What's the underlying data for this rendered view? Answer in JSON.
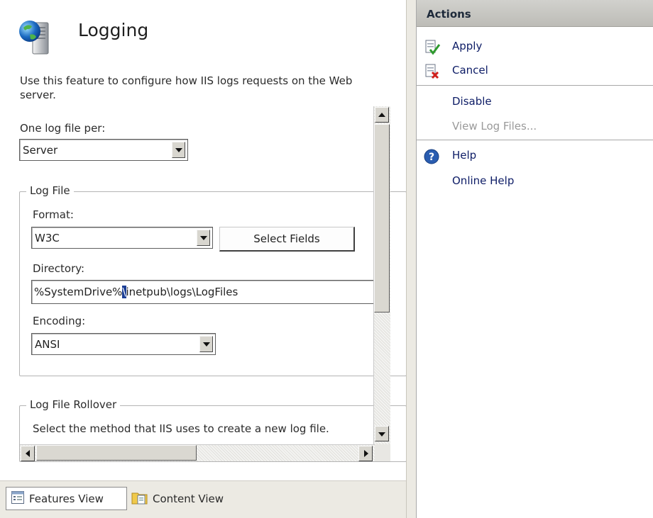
{
  "page": {
    "title": "Logging",
    "description": "Use this feature to configure how IIS logs requests on the Web server."
  },
  "log_per": {
    "label": "One log file per:",
    "value": "Server"
  },
  "log_file": {
    "group_title": "Log File",
    "format_label": "Format:",
    "format_value": "W3C",
    "select_fields_label": "Select Fields",
    "directory_label": "Directory:",
    "directory_value_before": "%SystemDrive%",
    "directory_value_selected": "\\",
    "directory_value_after": "inetpub\\logs\\LogFiles",
    "encoding_label": "Encoding:",
    "encoding_value": "ANSI"
  },
  "rollover": {
    "group_title": "Log File Rollover",
    "description": "Select the method that IIS uses to create a new log file."
  },
  "view_tabs": {
    "features": "Features View",
    "content": "Content View"
  },
  "actions": {
    "header": "Actions",
    "apply": "Apply",
    "cancel": "Cancel",
    "disable": "Disable",
    "view_log_files": "View Log Files...",
    "help": "Help",
    "online_help": "Online Help"
  },
  "colors": {
    "link": "#0d1c66",
    "disabled": "#9a9a9a",
    "selection": "#1c3f95",
    "apply_check": "#2e9a2e",
    "cancel_x": "#d0201c",
    "help_blue": "#2a5db0"
  },
  "icons": {
    "title": "logging-server-globe-icon",
    "apply": "apply-icon",
    "cancel": "cancel-icon",
    "help": "help-icon",
    "features_view": "features-view-icon",
    "content_view": "content-view-icon"
  }
}
